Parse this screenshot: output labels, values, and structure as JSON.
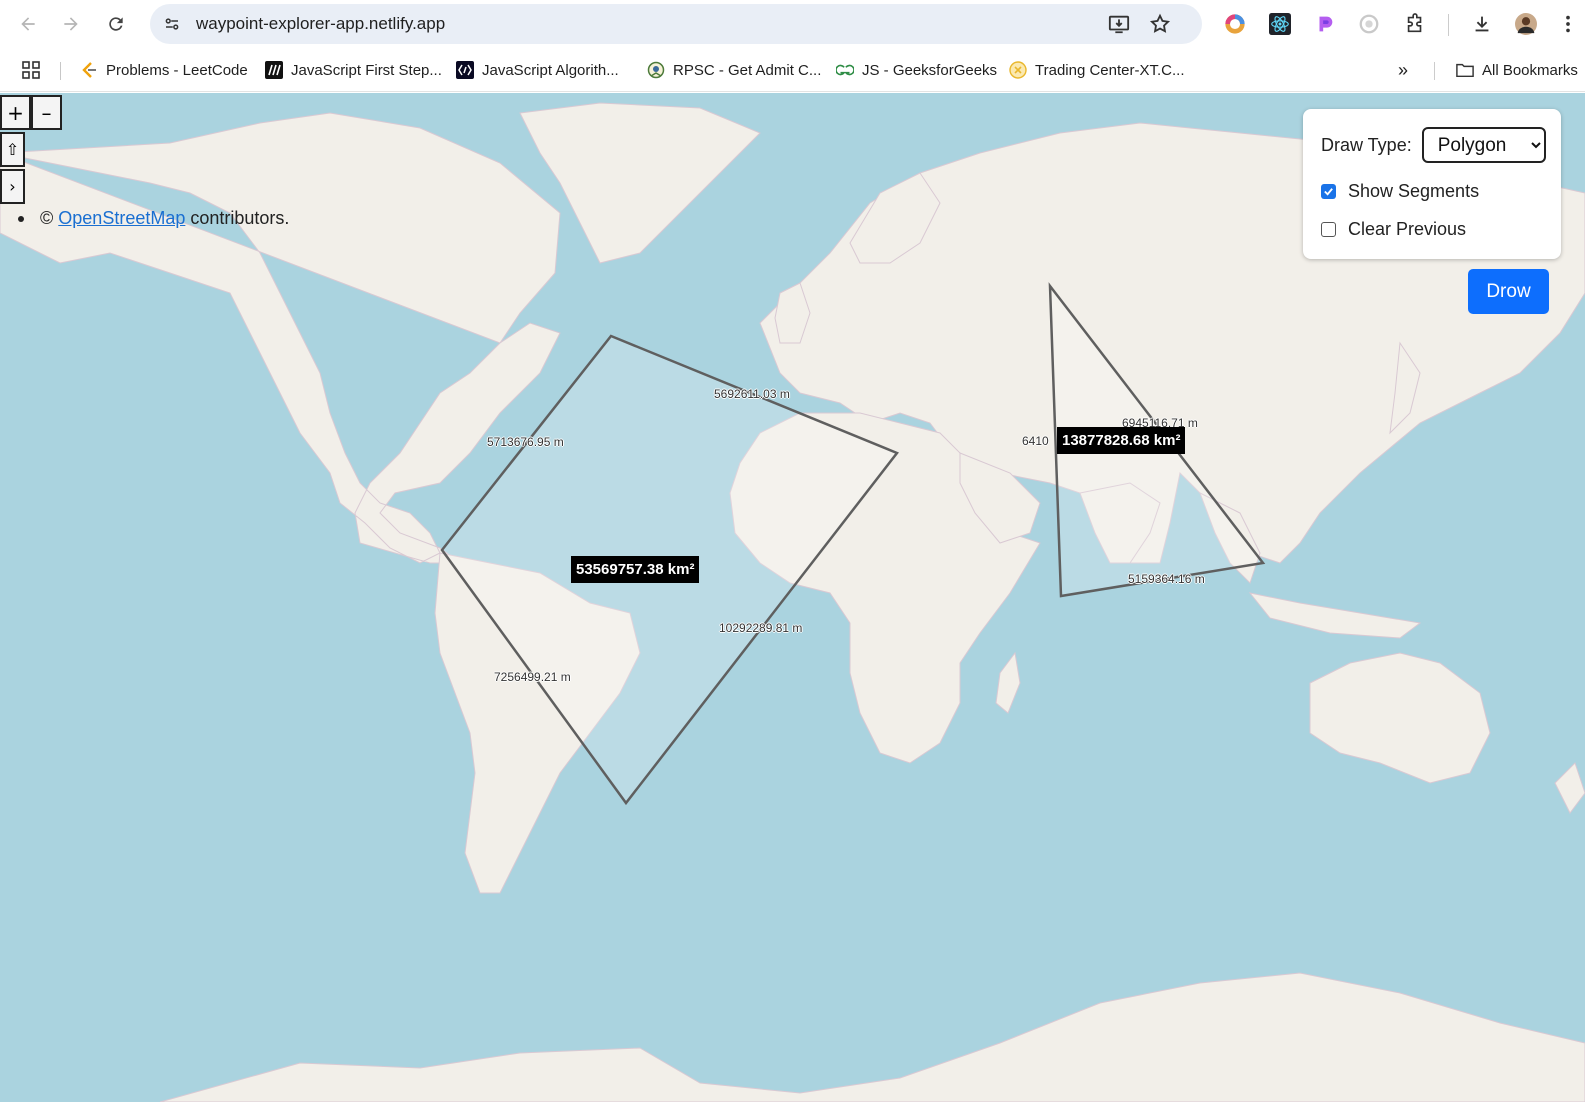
{
  "browser": {
    "url": "waypoint-explorer-app.netlify.app",
    "bookmarks": [
      {
        "label": "Problems - LeetCode",
        "icon": "leetcode-icon"
      },
      {
        "label": "JavaScript First Step...",
        "icon": "js-first-steps-icon"
      },
      {
        "label": "JavaScript Algorith...",
        "icon": "js-algorithms-icon"
      },
      {
        "label": "RPSC - Get Admit C...",
        "icon": "rpsc-icon"
      },
      {
        "label": "JS - GeeksforGeeks",
        "icon": "gfg-icon"
      },
      {
        "label": "Trading Center-XT.C...",
        "icon": "xt-icon"
      }
    ],
    "more_bookmarks": "»",
    "all_bookmarks": "All Bookmarks"
  },
  "map": {
    "zoom_in": "+",
    "zoom_out": "–",
    "rotate": "⇧",
    "attribution_toggle": "›",
    "attribution": {
      "prefix": "©",
      "link": "OpenStreetMap",
      "suffix": "contributors."
    },
    "polygons": [
      {
        "area": "53569757.38 km²",
        "segments": [
          "5692611.03 m",
          "5713676.95 m",
          "10292289.81 m",
          "7256499.21 m"
        ]
      },
      {
        "area": "13877828.68 km²",
        "segments": [
          "6945116.71 m",
          "6410",
          "5159364.16 m"
        ]
      }
    ]
  },
  "panel": {
    "draw_type_label": "Draw Type:",
    "draw_type_value": "Polygon",
    "show_segments_label": "Show Segments",
    "show_segments_checked": true,
    "clear_previous_label": "Clear Previous",
    "clear_previous_checked": false
  },
  "draw_button": "Drow",
  "colors": {
    "ocean": "#aad3df",
    "land": "#f2efe9",
    "accent": "#0d6efd",
    "checkbox": "#1a73e8"
  }
}
